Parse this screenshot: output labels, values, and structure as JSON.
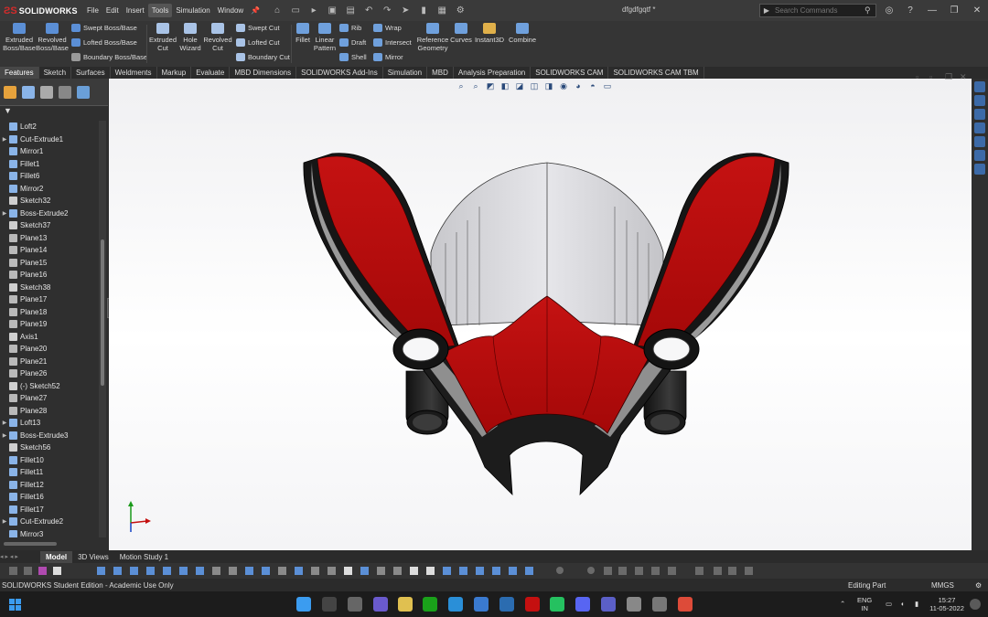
{
  "app": {
    "logo_text": "SOLIDWORKS",
    "doc_title": "dfgdfgqtf *"
  },
  "menu": [
    "File",
    "Edit",
    "Insert",
    "Tools",
    "Simulation",
    "Window"
  ],
  "menu_active": "Tools",
  "search": {
    "placeholder": "Search Commands"
  },
  "commands": {
    "extruded_boss": "Extruded Boss/Base",
    "revolved_boss": "Revolved Boss/Base",
    "swept_boss": "Swept Boss/Base",
    "lofted_boss": "Lofted Boss/Base",
    "boundary_boss": "Boundary Boss/Base",
    "extruded_cut": "Extruded Cut",
    "hole_wizard": "Hole Wizard",
    "revolved_cut": "Revolved Cut",
    "swept_cut": "Swept Cut",
    "lofted_cut": "Lofted Cut",
    "boundary_cut": "Boundary Cut",
    "fillet": "Fillet",
    "linear_pattern": "Linear Pattern",
    "rib": "Rib",
    "draft": "Draft",
    "shell": "Shell",
    "wrap": "Wrap",
    "intersect": "Intersect",
    "mirror": "Mirror",
    "reference_geometry": "Reference Geometry",
    "curves": "Curves",
    "instant3d": "Instant3D",
    "combine": "Combine"
  },
  "tabs": [
    "Features",
    "Sketch",
    "Surfaces",
    "Weldments",
    "Markup",
    "Evaluate",
    "MBD Dimensions",
    "SOLIDWORKS Add-Ins",
    "Simulation",
    "MBD",
    "Analysis Preparation",
    "SOLIDWORKS CAM",
    "SOLIDWORKS CAM TBM"
  ],
  "active_tab": "Features",
  "tree": [
    {
      "label": "Loft2",
      "expand": false,
      "kind": "feature"
    },
    {
      "label": "Cut-Extrude1",
      "expand": true,
      "kind": "feature"
    },
    {
      "label": "Mirror1",
      "expand": false,
      "kind": "feature"
    },
    {
      "label": "Fillet1",
      "expand": false,
      "kind": "feature"
    },
    {
      "label": "Fillet6",
      "expand": false,
      "kind": "feature"
    },
    {
      "label": "Mirror2",
      "expand": false,
      "kind": "feature"
    },
    {
      "label": "Sketch32",
      "expand": false,
      "kind": "sketch"
    },
    {
      "label": "Boss-Extrude2",
      "expand": true,
      "kind": "feature"
    },
    {
      "label": "Sketch37",
      "expand": false,
      "kind": "sketch"
    },
    {
      "label": "Plane13",
      "expand": false,
      "kind": "plane"
    },
    {
      "label": "Plane14",
      "expand": false,
      "kind": "plane"
    },
    {
      "label": "Plane15",
      "expand": false,
      "kind": "plane"
    },
    {
      "label": "Plane16",
      "expand": false,
      "kind": "plane"
    },
    {
      "label": "Sketch38",
      "expand": false,
      "kind": "sketch"
    },
    {
      "label": "Plane17",
      "expand": false,
      "kind": "plane"
    },
    {
      "label": "Plane18",
      "expand": false,
      "kind": "plane"
    },
    {
      "label": "Plane19",
      "expand": false,
      "kind": "plane"
    },
    {
      "label": "Axis1",
      "expand": false,
      "kind": "axis"
    },
    {
      "label": "Plane20",
      "expand": false,
      "kind": "plane"
    },
    {
      "label": "Plane21",
      "expand": false,
      "kind": "plane"
    },
    {
      "label": "Plane26",
      "expand": false,
      "kind": "plane"
    },
    {
      "label": "(-) Sketch52",
      "expand": false,
      "kind": "sketch"
    },
    {
      "label": "Plane27",
      "expand": false,
      "kind": "plane"
    },
    {
      "label": "Plane28",
      "expand": false,
      "kind": "plane"
    },
    {
      "label": "Loft13",
      "expand": true,
      "kind": "feature"
    },
    {
      "label": "Boss-Extrude3",
      "expand": true,
      "kind": "feature"
    },
    {
      "label": "Sketch56",
      "expand": false,
      "kind": "sketch"
    },
    {
      "label": "Fillet10",
      "expand": false,
      "kind": "feature"
    },
    {
      "label": "Fillet11",
      "expand": false,
      "kind": "feature"
    },
    {
      "label": "Fillet12",
      "expand": false,
      "kind": "feature"
    },
    {
      "label": "Fillet16",
      "expand": false,
      "kind": "feature"
    },
    {
      "label": "Fillet17",
      "expand": false,
      "kind": "feature"
    },
    {
      "label": "Cut-Extrude2",
      "expand": true,
      "kind": "feature"
    },
    {
      "label": "Mirror3",
      "expand": false,
      "kind": "feature"
    }
  ],
  "model_tabs": [
    "Model",
    "3D Views",
    "Motion Study 1"
  ],
  "active_model_tab": "Model",
  "status": {
    "edition": "SOLIDWORKS Student Edition - Academic Use Only",
    "mode": "Editing Part",
    "units": "MMGS"
  },
  "tray": {
    "lang": "ENG",
    "region": "IN",
    "time": "15:27",
    "date": "11-05-2022"
  },
  "colors": {
    "accent_red": "#c41010",
    "dark_body": "#2b2b2b",
    "taskbar": "#1c1c1c"
  }
}
